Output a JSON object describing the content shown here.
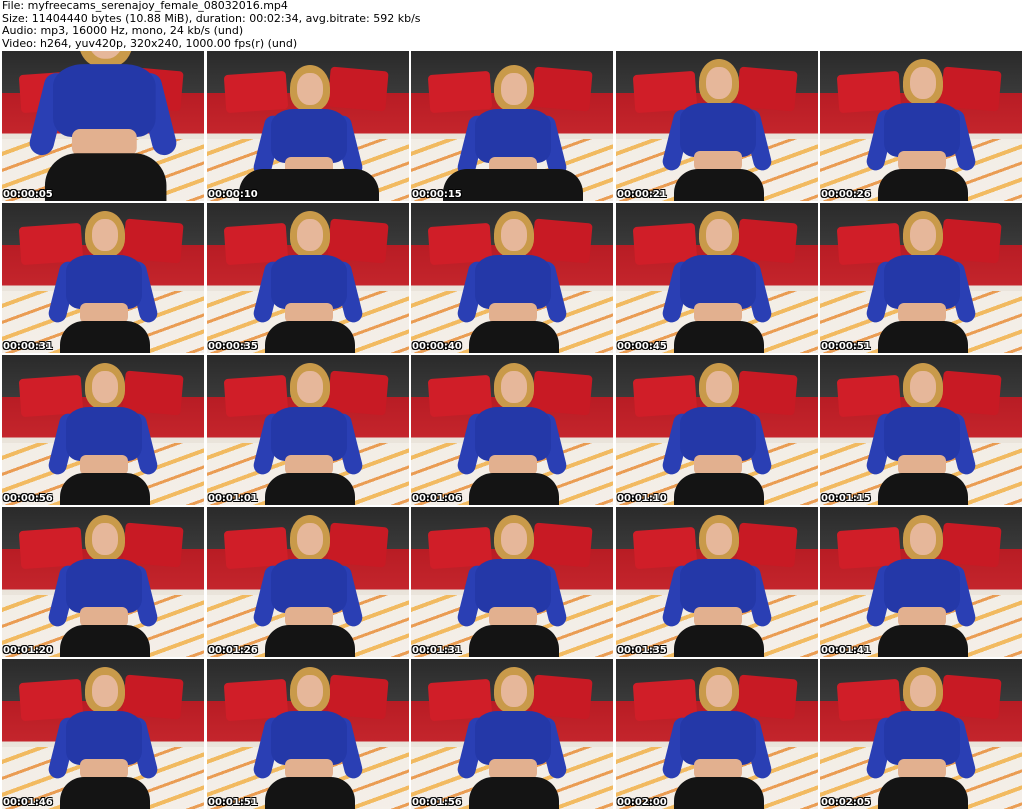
{
  "header": {
    "file_line": "File: myfreecams_serenajoy_female_08032016.mp4",
    "size_line": "Size: 11404440 bytes (10.88 MiB), duration: 00:02:34, avg.bitrate: 592 kb/s",
    "audio_line": "Audio: mp3, 16000 Hz, mono, 24 kb/s (und)",
    "video_line": "Video: h264, yuv420p, 320x240, 1000.00 fps(r) (und)"
  },
  "thumbnails": [
    {
      "timestamp": "00:00:05"
    },
    {
      "timestamp": "00:00:10"
    },
    {
      "timestamp": "00:00:15"
    },
    {
      "timestamp": "00:00:21"
    },
    {
      "timestamp": "00:00:26"
    },
    {
      "timestamp": "00:00:31"
    },
    {
      "timestamp": "00:00:35"
    },
    {
      "timestamp": "00:00:40"
    },
    {
      "timestamp": "00:00:45"
    },
    {
      "timestamp": "00:00:51"
    },
    {
      "timestamp": "00:00:56"
    },
    {
      "timestamp": "00:01:01"
    },
    {
      "timestamp": "00:01:06"
    },
    {
      "timestamp": "00:01:10"
    },
    {
      "timestamp": "00:01:15"
    },
    {
      "timestamp": "00:01:20"
    },
    {
      "timestamp": "00:01:26"
    },
    {
      "timestamp": "00:01:31"
    },
    {
      "timestamp": "00:01:35"
    },
    {
      "timestamp": "00:01:41"
    },
    {
      "timestamp": "00:01:46"
    },
    {
      "timestamp": "00:01:51"
    },
    {
      "timestamp": "00:01:56"
    },
    {
      "timestamp": "00:02:00"
    },
    {
      "timestamp": "00:02:05"
    }
  ]
}
